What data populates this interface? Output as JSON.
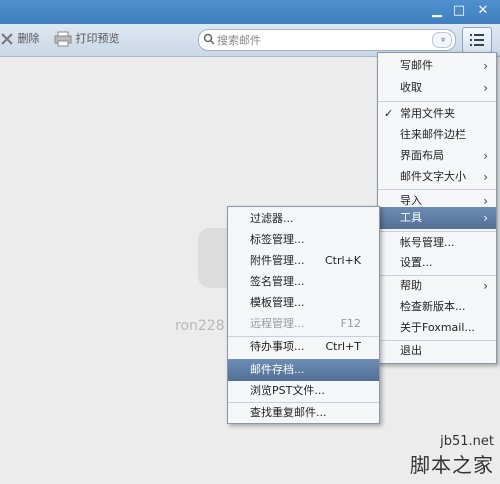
{
  "window": {
    "min_glyph": "▁",
    "max_glyph": "□",
    "close_glyph": "✕"
  },
  "toolbar": {
    "delete_label": "删除",
    "print_label": "打印预览",
    "search_placeholder": "搜索邮件",
    "search_dropdown_glyph": "»"
  },
  "background": {
    "account_text": "ron228"
  },
  "main_menu": {
    "items": [
      {
        "label": "写邮件",
        "submenu": true
      },
      {
        "label": "收取",
        "submenu": true
      },
      {
        "label": "常用文件夹",
        "checked": true
      },
      {
        "label": "往来邮件边栏"
      },
      {
        "label": "界面布局",
        "submenu": true
      },
      {
        "label": "邮件文字大小",
        "submenu": true
      },
      {
        "label": "导入",
        "submenu": true
      },
      {
        "label": "工具",
        "submenu": true,
        "highlighted": true
      },
      {
        "label": "帐号管理..."
      },
      {
        "label": "设置..."
      },
      {
        "label": "帮助",
        "submenu": true
      },
      {
        "label": "检查新版本..."
      },
      {
        "label": "关于Foxmail..."
      },
      {
        "label": "退出"
      }
    ]
  },
  "tools_menu": {
    "items": [
      {
        "label": "过滤器..."
      },
      {
        "label": "标签管理..."
      },
      {
        "label": "附件管理...",
        "shortcut": "Ctrl+K"
      },
      {
        "label": "签名管理..."
      },
      {
        "label": "模板管理..."
      },
      {
        "label": "远程管理...",
        "shortcut": "F12",
        "disabled": true
      },
      {
        "label": "待办事项...",
        "shortcut": "Ctrl+T"
      },
      {
        "label": "邮件存档...",
        "highlighted": true
      },
      {
        "label": "浏览PST文件..."
      },
      {
        "label": "查找重复邮件..."
      }
    ]
  },
  "site_watermark": {
    "line1": "jb51.net",
    "line2": "脚本之家"
  }
}
